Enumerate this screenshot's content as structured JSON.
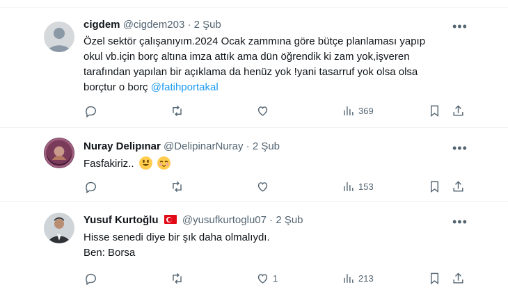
{
  "tweets": [
    {
      "name": "cigdem",
      "handle": "@cigdem203",
      "time": "· 2 Şub",
      "lines": [
        "Özel sektör çalışanıyım.2024 Ocak zammına göre bütçe planlaması yapıp",
        "okul vb.için borç altına imza attık ama dün öğrendik ki zam yok,işveren",
        "tarafından yapılan bir açıklama da henüz yok !yani tasarruf yok olsa olsa",
        "borçtur o borç "
      ],
      "mention": "@fatihportakal",
      "replies": "",
      "retweets": "",
      "likes": "",
      "views": "369",
      "more": "•••"
    },
    {
      "name": "Nuray Delipınar",
      "handle": "@DelipinarNuray",
      "time": "· 2 Şub",
      "text": "Fasfakiriz..",
      "replies": "",
      "retweets": "",
      "likes": "",
      "views": "153",
      "more": "•••"
    },
    {
      "name": "Yusuf Kurtoğlu",
      "handle": "@yusufkurtoglu07",
      "time": "· 2 Şub",
      "lines": [
        "Hisse senedi diye bir şık daha olmalıydı.",
        "Ben: Borsa"
      ],
      "replies": "",
      "retweets": "",
      "likes": "1",
      "views": "213",
      "more": "•••"
    }
  ],
  "icons": [
    "reply-icon",
    "retweet-icon",
    "like-icon",
    "views-icon",
    "bookmark-icon",
    "share-icon"
  ]
}
